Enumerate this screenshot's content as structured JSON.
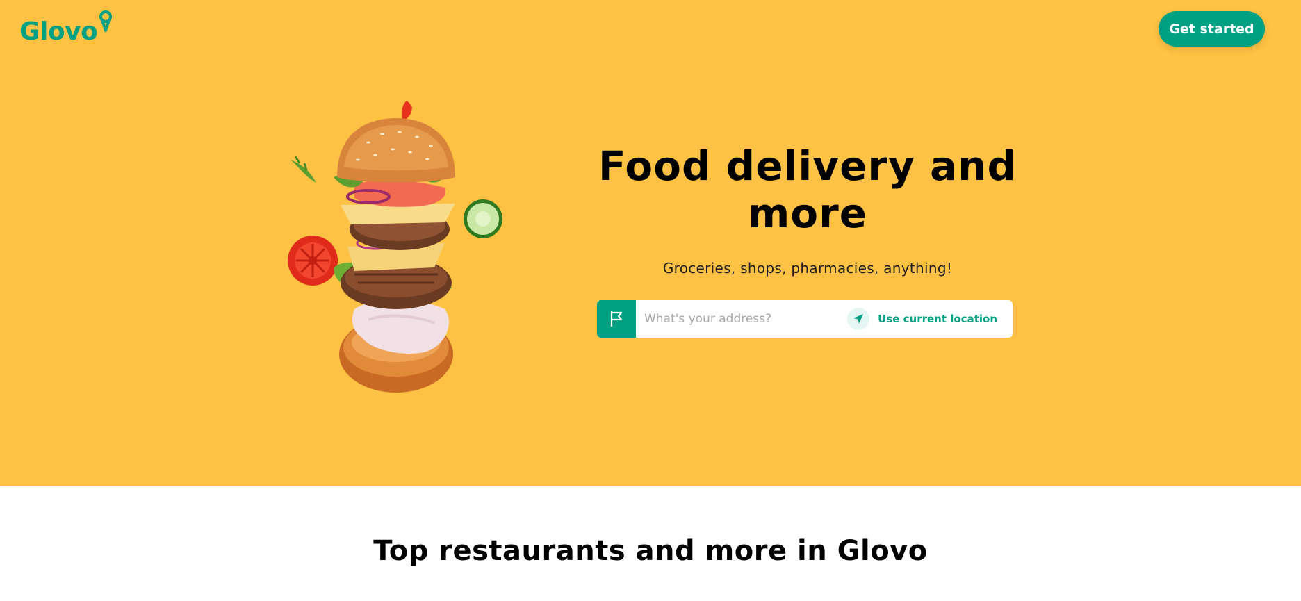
{
  "brand": {
    "logo_text": "Glovo",
    "accent": "#00a082",
    "hero_bg": "#ffc244"
  },
  "header": {
    "get_started_label": "Get started"
  },
  "hero": {
    "title": "Food delivery and more",
    "subtitle": "Groceries, shops, pharmacies, anything!",
    "image_subject": "burger-image"
  },
  "address": {
    "placeholder": "What's your address?",
    "flag_icon": "flag-icon",
    "location_icon": "navigation-arrow-icon",
    "use_location_label": "Use current location"
  },
  "sections": {
    "top_restaurants_title": "Top restaurants and more in Glovo"
  }
}
